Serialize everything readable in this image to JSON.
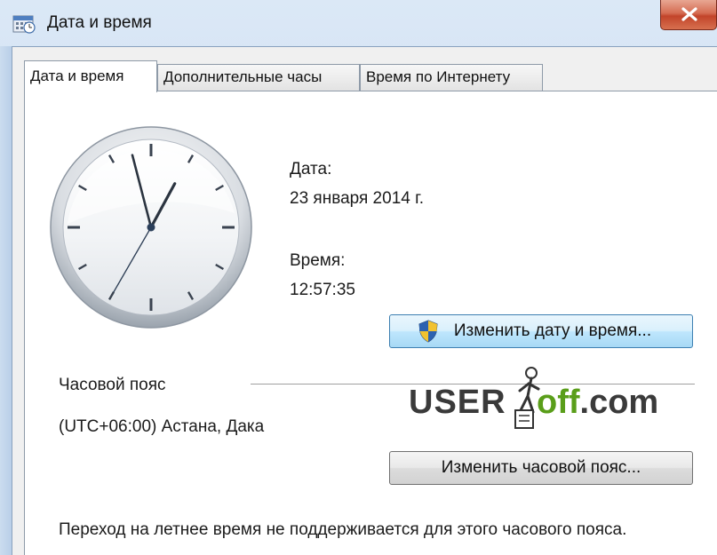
{
  "window": {
    "title": "Дата и время",
    "close_icon": "close-icon"
  },
  "tabs": [
    {
      "label": "Дата и время",
      "active": true
    },
    {
      "label": "Дополнительные часы",
      "active": false
    },
    {
      "label": "Время по Интернету",
      "active": false
    }
  ],
  "datetime": {
    "date_label": "Дата:",
    "date_value": "23 января 2014 г.",
    "time_label": "Время:",
    "time_value": "12:57:35",
    "change_button": "Изменить дату и время...",
    "change_button_icon": "uac-shield-icon"
  },
  "clock": {
    "hours": 12,
    "minutes": 57,
    "seconds": 35
  },
  "timezone": {
    "section_label": "Часовой пояс",
    "value": "(UTC+06:00) Астана, Дака",
    "change_button": "Изменить часовой пояс..."
  },
  "watermark": {
    "text": "USERoff.com"
  },
  "footer": {
    "dst_note": "Переход на летнее время не поддерживается для этого часового пояса."
  }
}
